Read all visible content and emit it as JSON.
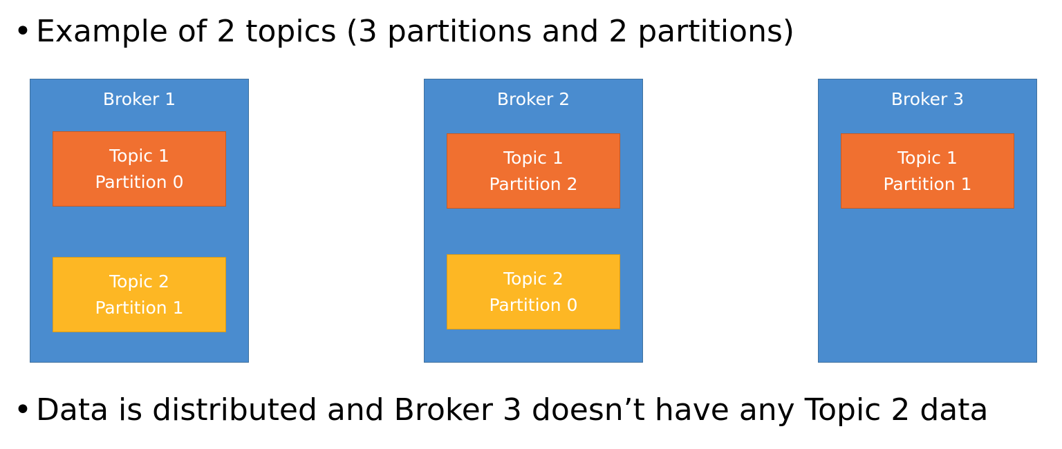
{
  "bullets": {
    "top_text": "Example of 2 topics (3 partitions and 2 partitions)",
    "bottom_text": "Data is distributed and Broker 3 doesn’t have any Topic 2 data",
    "marker": "•"
  },
  "colors": {
    "broker": "#4a8ccf",
    "topic1": "#f07030",
    "topic2": "#fdb724"
  },
  "brokers": [
    {
      "title": "Broker 1",
      "partitions": [
        {
          "topic": "Topic 1",
          "partition": "Partition 0"
        },
        {
          "topic": "Topic 2",
          "partition": "Partition 1"
        }
      ]
    },
    {
      "title": "Broker 2",
      "partitions": [
        {
          "topic": "Topic 1",
          "partition": "Partition 2"
        },
        {
          "topic": "Topic 2",
          "partition": "Partition 0"
        }
      ]
    },
    {
      "title": "Broker 3",
      "partitions": [
        {
          "topic": "Topic 1",
          "partition": "Partition 1"
        }
      ]
    }
  ]
}
